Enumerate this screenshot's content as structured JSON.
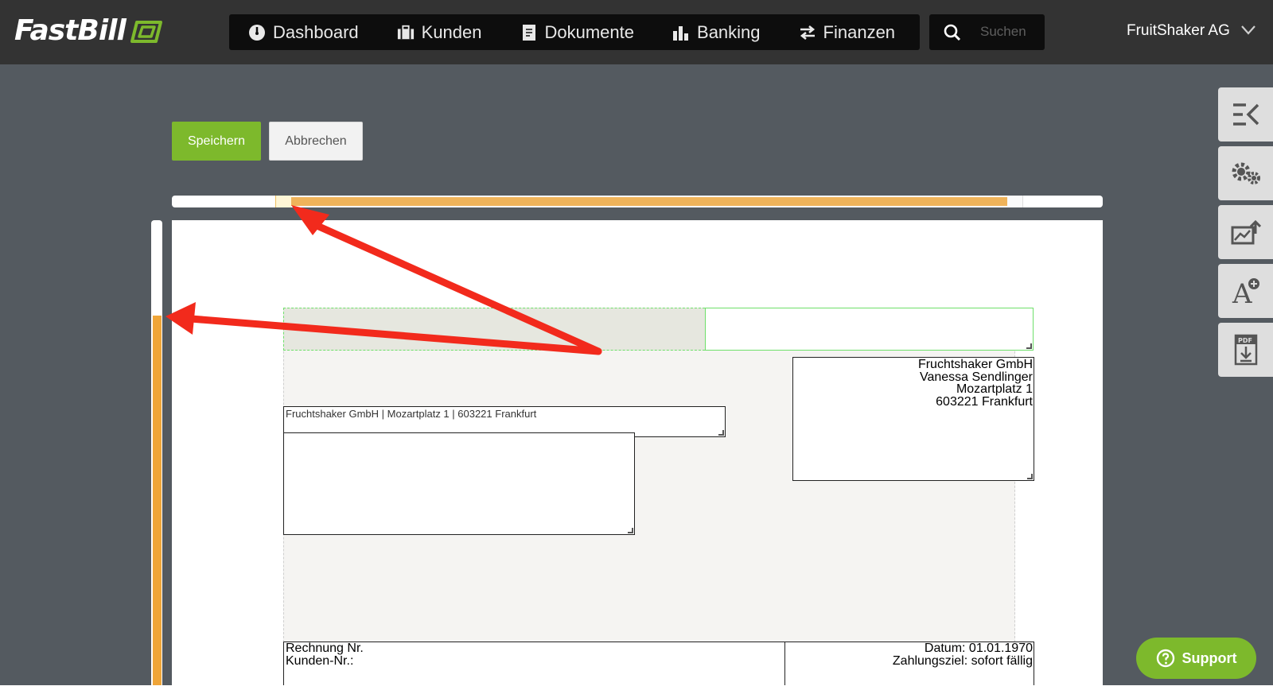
{
  "app": {
    "logo_text": "FastBill",
    "company_name": "FruitShaker AG"
  },
  "nav": {
    "items": [
      {
        "label": "Dashboard",
        "icon": "dashboard-gauge-icon"
      },
      {
        "label": "Kunden",
        "icon": "briefcase-icon"
      },
      {
        "label": "Dokumente",
        "icon": "document-icon"
      },
      {
        "label": "Banking",
        "icon": "bar-chart-icon"
      },
      {
        "label": "Finanzen",
        "icon": "transfer-arrows-icon"
      }
    ],
    "search_placeholder": "Suchen"
  },
  "toolbar": {
    "save_label": "Speichern",
    "cancel_label": "Abbrechen"
  },
  "document": {
    "sender_line": "Fruchtshaker GmbH | Mozartplatz 1 | 603221 Frankfurt",
    "address_lines": [
      "Fruchtshaker GmbH",
      "Vanessa Sendlinger",
      "Mozartplatz 1",
      "603221 Frankfurt"
    ],
    "invoice_left": [
      "Rechnung Nr.",
      "Kunden-Nr.:"
    ],
    "invoice_right": [
      "Datum: 01.01.1970",
      "Zahlungsziel: sofort fällig"
    ]
  },
  "sidebar_tools": [
    {
      "icon": "collapse-panel-icon"
    },
    {
      "icon": "settings-gears-icon"
    },
    {
      "icon": "image-upload-icon"
    },
    {
      "icon": "add-font-icon"
    },
    {
      "icon": "pdf-download-icon"
    }
  ],
  "support": {
    "label": "Support"
  },
  "colors": {
    "brand_green": "#7db92c",
    "ruler_orange": "#efa538",
    "annotation_red": "#f22a1c"
  }
}
